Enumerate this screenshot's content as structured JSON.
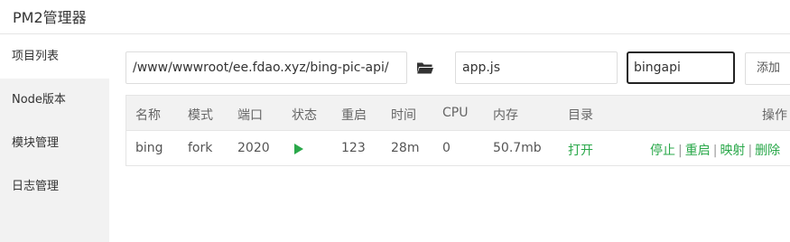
{
  "app": {
    "title": "PM2管理器"
  },
  "sidebar": {
    "items": [
      {
        "label": "项目列表",
        "active": true
      },
      {
        "label": "Node版本",
        "active": false
      },
      {
        "label": "模块管理",
        "active": false
      },
      {
        "label": "日志管理",
        "active": false
      }
    ]
  },
  "toolbar": {
    "path_value": "/www/wwwroot/ee.fdao.xyz/bing-pic-api/",
    "folder_icon": "folder-open-icon",
    "script_value": "app.js",
    "name_value": "bingapi",
    "add_label": "添加"
  },
  "table": {
    "headers": {
      "name": "名称",
      "mode": "模式",
      "port": "端口",
      "status": "状态",
      "restarts": "重启",
      "time": "时间",
      "cpu": "CPU",
      "memory": "内存",
      "dir": "目录",
      "ops": "操作"
    },
    "rows": [
      {
        "name": "bing",
        "mode": "fork",
        "port": "2020",
        "status_icon": "play-icon",
        "restarts": "123",
        "time": "28m",
        "cpu": "0",
        "memory": "50.7mb",
        "dir": "打开",
        "actions": [
          "停止",
          "重启",
          "映射",
          "删除"
        ],
        "separator": "|"
      }
    ]
  },
  "colors": {
    "accent_green": "#2aa84a",
    "sidebar_bg": "#f2f2f2",
    "header_bg": "#f2f2f2"
  }
}
